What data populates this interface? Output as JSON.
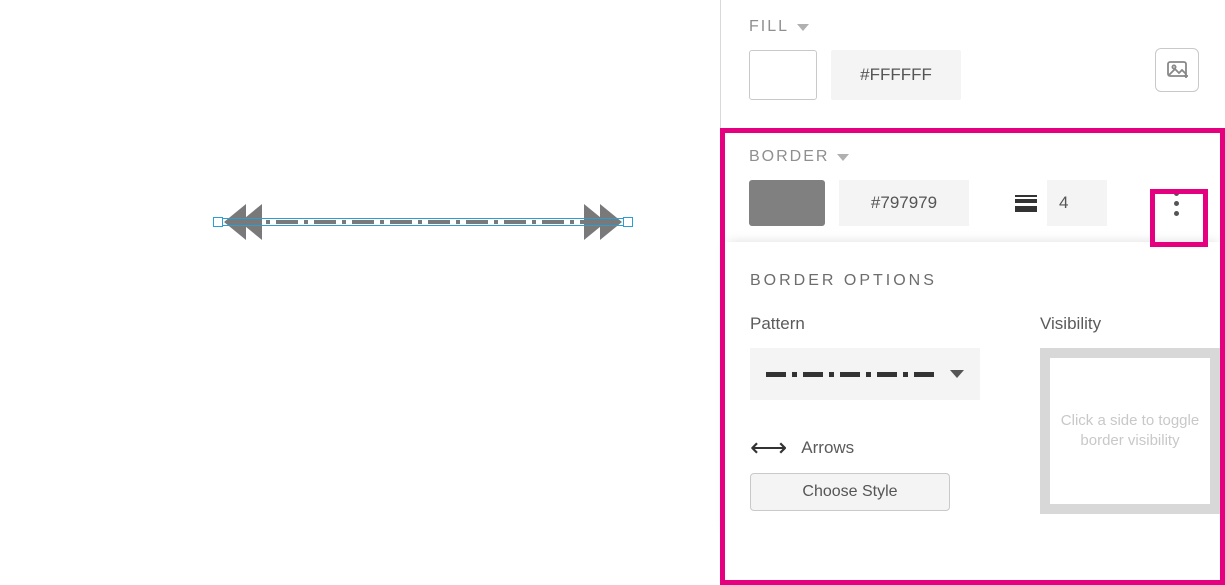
{
  "canvas": {
    "selected_color": "#797979"
  },
  "panel": {
    "fill": {
      "title": "FILL",
      "hex": "#FFFFFF"
    },
    "border": {
      "title": "BORDER",
      "hex": "#797979",
      "width": "4"
    },
    "border_options": {
      "title": "BORDER OPTIONS",
      "pattern_label": "Pattern",
      "visibility_label": "Visibility",
      "visibility_hint": "Click a side to toggle border visibility",
      "arrows_label": "Arrows",
      "choose_style_label": "Choose Style"
    }
  }
}
